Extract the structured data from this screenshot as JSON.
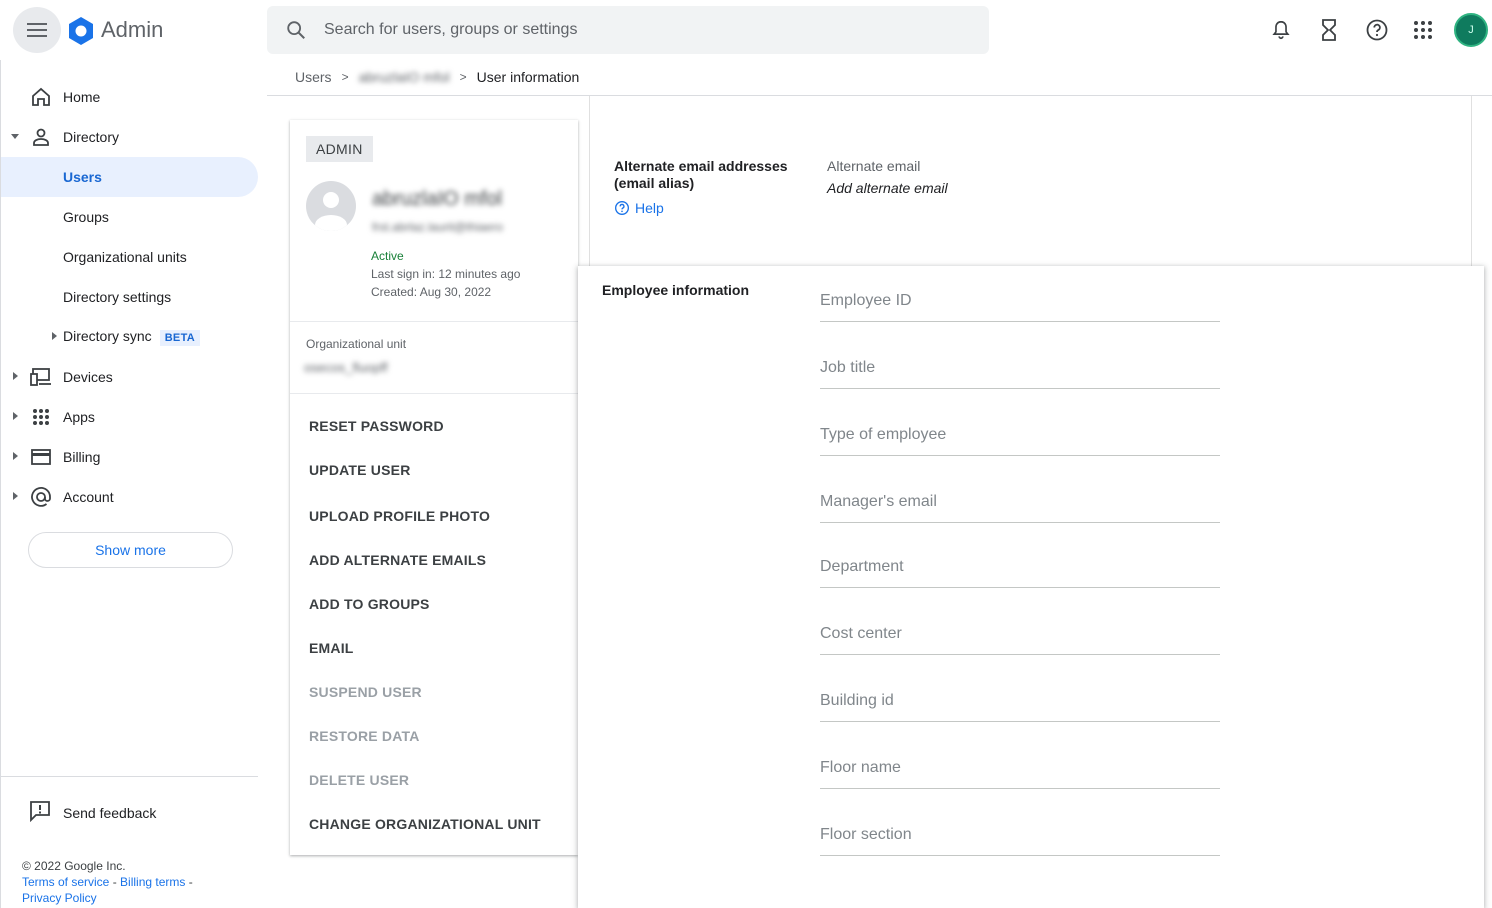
{
  "header": {
    "app_title": "Admin",
    "search_placeholder": "Search for users, groups or settings",
    "avatar_initial": "J",
    "colors": {
      "brand_blue": "#1a73e8",
      "avatar_green": "#0f7b5e"
    },
    "icons": [
      "menu-icon",
      "admin-logo-icon",
      "search-icon",
      "bell-icon",
      "hourglass-icon",
      "help-icon",
      "apps-grid-icon"
    ]
  },
  "sidebar": {
    "items": [
      {
        "label": "Home",
        "icon": "home-icon"
      },
      {
        "label": "Directory",
        "icon": "person-icon",
        "expanded": true
      },
      {
        "label": "Users",
        "active": true
      },
      {
        "label": "Groups"
      },
      {
        "label": "Organizational units"
      },
      {
        "label": "Directory settings"
      },
      {
        "label": "Directory sync",
        "badge": "BETA"
      },
      {
        "label": "Devices",
        "icon": "devices-icon"
      },
      {
        "label": "Apps",
        "icon": "apps-icon"
      },
      {
        "label": "Billing",
        "icon": "billing-card-icon"
      },
      {
        "label": "Account",
        "icon": "at-sign-icon"
      }
    ],
    "show_more": "Show more",
    "feedback": "Send feedback",
    "footer": {
      "copyright": "© 2022 Google Inc.",
      "terms": "Terms of service",
      "billing_terms": "Billing terms",
      "privacy": "Privacy Policy",
      "sep": " - "
    }
  },
  "breadcrumb": {
    "root": "Users",
    "user": "abruzlaIO mfol",
    "current": "User information"
  },
  "user_card": {
    "role_chip": "ADMIN",
    "name": "abruzlaIO mfol",
    "email": "frst.abrlaz.laurit@thiaero",
    "status": "Active",
    "last_sign_in": "Last sign in: 12 minutes ago",
    "created": "Created: Aug 30, 2022",
    "ou_label": "Organizational unit",
    "ou_value": "osecos_fluopff",
    "actions": [
      {
        "label": "RESET PASSWORD",
        "enabled": true
      },
      {
        "label": "UPDATE USER",
        "enabled": true
      },
      {
        "label": "UPLOAD PROFILE PHOTO",
        "enabled": true
      },
      {
        "label": "ADD ALTERNATE EMAILS",
        "enabled": true
      },
      {
        "label": "ADD TO GROUPS",
        "enabled": true
      },
      {
        "label": "EMAIL",
        "enabled": true
      },
      {
        "label": "SUSPEND USER",
        "enabled": false
      },
      {
        "label": "RESTORE DATA",
        "enabled": false
      },
      {
        "label": "DELETE USER",
        "enabled": false
      },
      {
        "label": "CHANGE ORGANIZATIONAL UNIT",
        "enabled": true
      }
    ]
  },
  "alternate_email": {
    "title": "Alternate email addresses (email alias)",
    "help": "Help",
    "label": "Alternate email",
    "value": "Add alternate email"
  },
  "employee_info": {
    "title": "Employee information",
    "fields": [
      {
        "placeholder": "Employee ID",
        "value": ""
      },
      {
        "placeholder": "Job title",
        "value": ""
      },
      {
        "placeholder": "Type of employee",
        "value": ""
      },
      {
        "placeholder": "Manager's email",
        "value": ""
      },
      {
        "placeholder": "Department",
        "value": ""
      },
      {
        "placeholder": "Cost center",
        "value": ""
      },
      {
        "placeholder": "Building id",
        "value": ""
      },
      {
        "placeholder": "Floor name",
        "value": ""
      },
      {
        "placeholder": "Floor section",
        "value": ""
      }
    ]
  }
}
